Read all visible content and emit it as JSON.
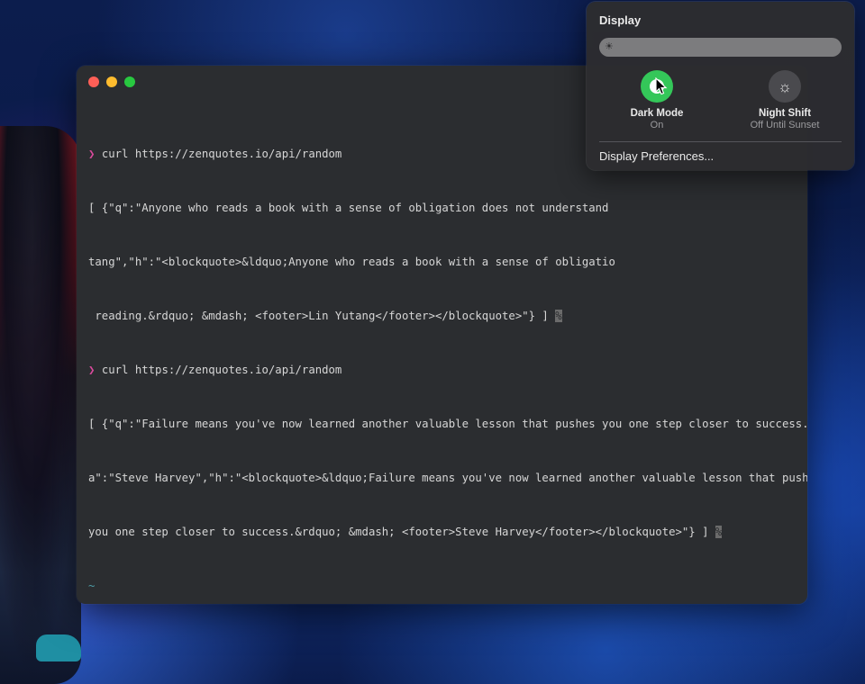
{
  "terminal": {
    "lines": [
      {
        "type": "command",
        "prompt": "❯",
        "text": "curl https://zenquotes.io/api/random"
      },
      {
        "type": "output",
        "text": "[ {\"q\":\"Anyone who reads a book with a sense of obligation does not understand"
      },
      {
        "type": "output",
        "text": "tang\",\"h\":\"<blockquote>&ldquo;Anyone who reads a book with a sense of obligatio"
      },
      {
        "type": "output-end",
        "text": " reading.&rdquo; &mdash; <footer>Lin Yutang</footer></blockquote>\"} ]",
        "marker": "%"
      },
      {
        "type": "command",
        "prompt": "❯",
        "text": "curl https://zenquotes.io/api/random"
      },
      {
        "type": "output",
        "text": "[ {\"q\":\"Failure means you've now learned another valuable lesson that pushes you one step closer to success.\",\""
      },
      {
        "type": "output",
        "text": "a\":\"Steve Harvey\",\"h\":\"<blockquote>&ldquo;Failure means you've now learned another valuable lesson that pushes"
      },
      {
        "type": "output-end",
        "text": "you one step closer to success.&rdquo; &mdash; <footer>Steve Harvey</footer></blockquote>\"} ]",
        "marker": "%"
      },
      {
        "type": "dir",
        "text": "~"
      },
      {
        "type": "prompt",
        "prompt": "❯",
        "text": ""
      }
    ]
  },
  "display_panel": {
    "title": "Display",
    "dark_mode": {
      "label": "Dark Mode",
      "status": "On"
    },
    "night_shift": {
      "label": "Night Shift",
      "status": "Off Until Sunset"
    },
    "preferences_label": "Display Preferences..."
  },
  "colors": {
    "terminal_bg": "#2b2d30",
    "prompt": "#d94a9c",
    "dark_mode_on": "#34c759"
  },
  "icons": {
    "brightness": "sun-icon",
    "dark_mode": "dark-mode-icon",
    "night_shift": "night-shift-icon",
    "pointer": "mouse-pointer-icon"
  }
}
